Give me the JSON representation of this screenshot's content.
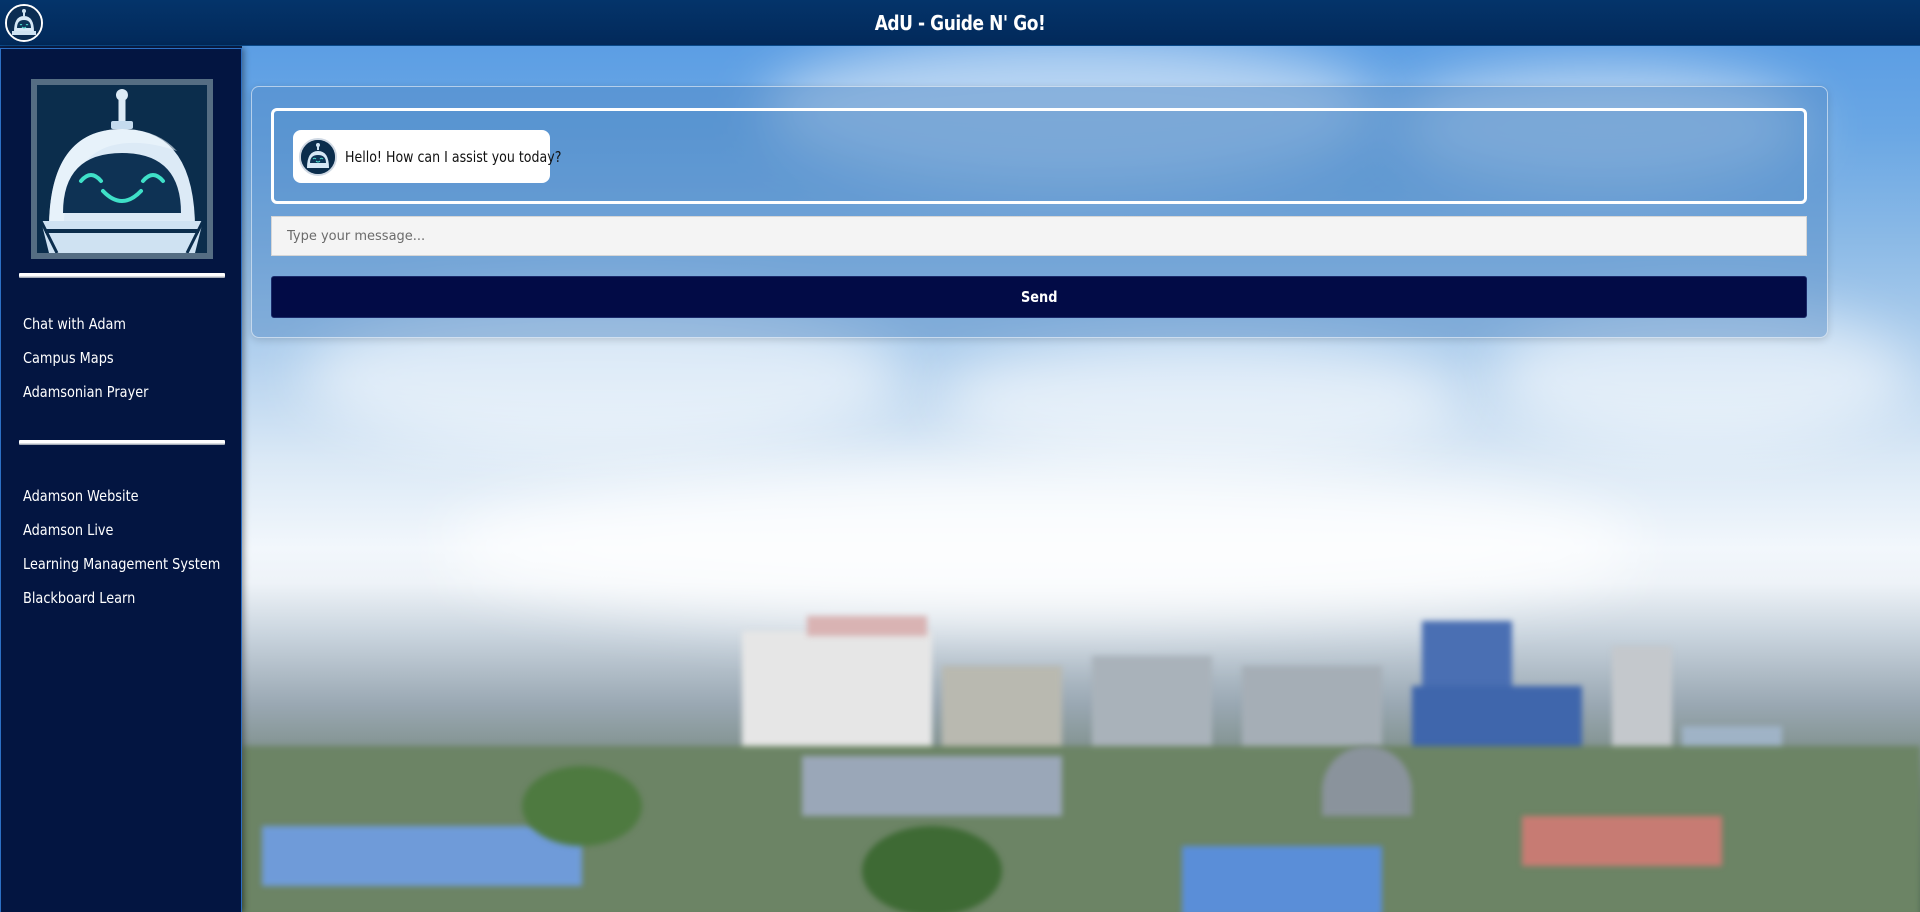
{
  "app": {
    "title": "AdU - Guide N' Go!"
  },
  "sidebar": {
    "primary_links": [
      {
        "label": "Chat with Adam"
      },
      {
        "label": "Campus Maps"
      },
      {
        "label": "Adamsonian Prayer"
      }
    ],
    "external_links": [
      {
        "label": "Adamson Website"
      },
      {
        "label": "Adamson Live"
      },
      {
        "label": "Learning Management System"
      },
      {
        "label": "Blackboard Learn"
      }
    ]
  },
  "chat": {
    "messages": [
      {
        "sender": "bot",
        "text": "Hello! How can I assist you today?"
      }
    ],
    "input": {
      "value": "",
      "placeholder": "Type your message..."
    },
    "send_label": "Send"
  },
  "icons": {
    "header_logo": "robot-mascot-icon",
    "sidebar_avatar": "robot-mascot-icon",
    "bot_avatar": "robot-mascot-icon"
  },
  "colors": {
    "header_bg": "#03316a",
    "sidebar_bg": "#031541",
    "send_button_bg": "#020b46",
    "panel_border": "#ffffff"
  }
}
